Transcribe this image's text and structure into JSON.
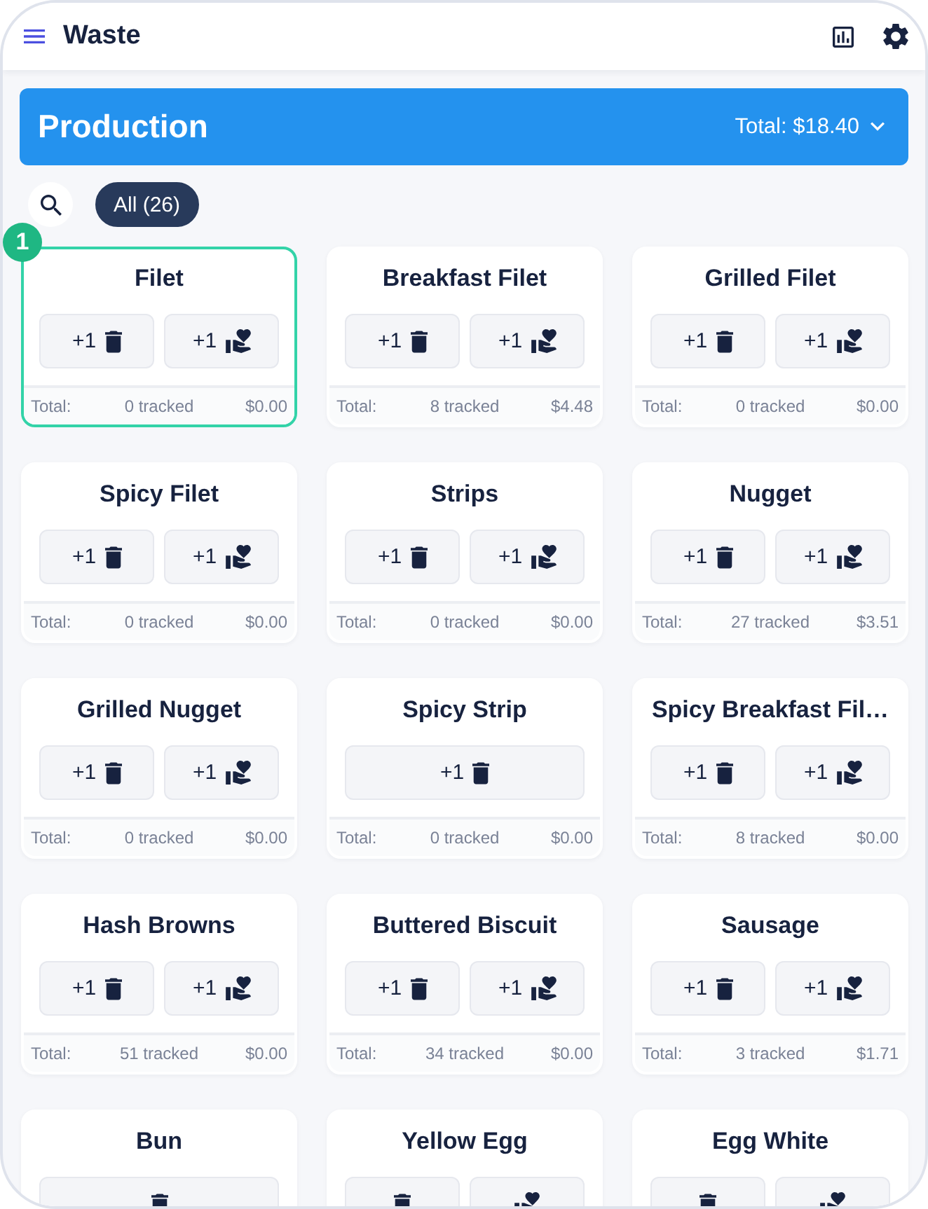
{
  "header": {
    "title": "Waste"
  },
  "banner": {
    "title": "Production",
    "total": "Total: $18.40"
  },
  "filters": {
    "chips": [
      {
        "label": "All (26)",
        "selected": true
      }
    ]
  },
  "items": [
    {
      "name": "Filet",
      "selected": true,
      "badge": "1",
      "buttons": [
        {
          "kind": "waste",
          "label": "+1"
        },
        {
          "kind": "donate",
          "label": "+1"
        }
      ],
      "footer": {
        "label": "Total:",
        "tracked": "0 tracked",
        "amount": "$0.00"
      }
    },
    {
      "name": "Breakfast Filet",
      "selected": false,
      "buttons": [
        {
          "kind": "waste",
          "label": "+1"
        },
        {
          "kind": "donate",
          "label": "+1"
        }
      ],
      "footer": {
        "label": "Total:",
        "tracked": "8 tracked",
        "amount": "$4.48"
      }
    },
    {
      "name": "Grilled Filet",
      "selected": false,
      "buttons": [
        {
          "kind": "waste",
          "label": "+1"
        },
        {
          "kind": "donate",
          "label": "+1"
        }
      ],
      "footer": {
        "label": "Total:",
        "tracked": "0 tracked",
        "amount": "$0.00"
      }
    },
    {
      "name": "Spicy Filet",
      "selected": false,
      "buttons": [
        {
          "kind": "waste",
          "label": "+1"
        },
        {
          "kind": "donate",
          "label": "+1"
        }
      ],
      "footer": {
        "label": "Total:",
        "tracked": "0 tracked",
        "amount": "$0.00"
      }
    },
    {
      "name": "Strips",
      "selected": false,
      "buttons": [
        {
          "kind": "waste",
          "label": "+1"
        },
        {
          "kind": "donate",
          "label": "+1"
        }
      ],
      "footer": {
        "label": "Total:",
        "tracked": "0 tracked",
        "amount": "$0.00"
      }
    },
    {
      "name": "Nugget",
      "selected": false,
      "buttons": [
        {
          "kind": "waste",
          "label": "+1"
        },
        {
          "kind": "donate",
          "label": "+1"
        }
      ],
      "footer": {
        "label": "Total:",
        "tracked": "27 tracked",
        "amount": "$3.51"
      }
    },
    {
      "name": "Grilled Nugget",
      "selected": false,
      "buttons": [
        {
          "kind": "waste",
          "label": "+1"
        },
        {
          "kind": "donate",
          "label": "+1"
        }
      ],
      "footer": {
        "label": "Total:",
        "tracked": "0 tracked",
        "amount": "$0.00"
      }
    },
    {
      "name": "Spicy Strip",
      "selected": false,
      "buttons": [
        {
          "kind": "waste",
          "label": "+1"
        }
      ],
      "footer": {
        "label": "Total:",
        "tracked": "0 tracked",
        "amount": "$0.00"
      }
    },
    {
      "name": "Spicy Breakfast Fil…",
      "selected": false,
      "buttons": [
        {
          "kind": "waste",
          "label": "+1"
        },
        {
          "kind": "donate",
          "label": "+1"
        }
      ],
      "footer": {
        "label": "Total:",
        "tracked": "8 tracked",
        "amount": "$0.00"
      }
    },
    {
      "name": "Hash Browns",
      "selected": false,
      "buttons": [
        {
          "kind": "waste",
          "label": "+1"
        },
        {
          "kind": "donate",
          "label": "+1"
        }
      ],
      "footer": {
        "label": "Total:",
        "tracked": "51 tracked",
        "amount": "$0.00"
      }
    },
    {
      "name": "Buttered Biscuit",
      "selected": false,
      "buttons": [
        {
          "kind": "waste",
          "label": "+1"
        },
        {
          "kind": "donate",
          "label": "+1"
        }
      ],
      "footer": {
        "label": "Total:",
        "tracked": "34 tracked",
        "amount": "$0.00"
      }
    },
    {
      "name": "Sausage",
      "selected": false,
      "buttons": [
        {
          "kind": "waste",
          "label": "+1"
        },
        {
          "kind": "donate",
          "label": "+1"
        }
      ],
      "footer": {
        "label": "Total:",
        "tracked": "3 tracked",
        "amount": "$1.71"
      }
    },
    {
      "name": "Bun",
      "selected": false,
      "buttons": [
        {
          "kind": "waste"
        }
      ]
    },
    {
      "name": "Yellow Egg",
      "selected": false,
      "buttons": [
        {
          "kind": "waste"
        },
        {
          "kind": "donate"
        }
      ]
    },
    {
      "name": "Egg White",
      "selected": false,
      "buttons": [
        {
          "kind": "waste"
        },
        {
          "kind": "donate"
        }
      ]
    }
  ]
}
